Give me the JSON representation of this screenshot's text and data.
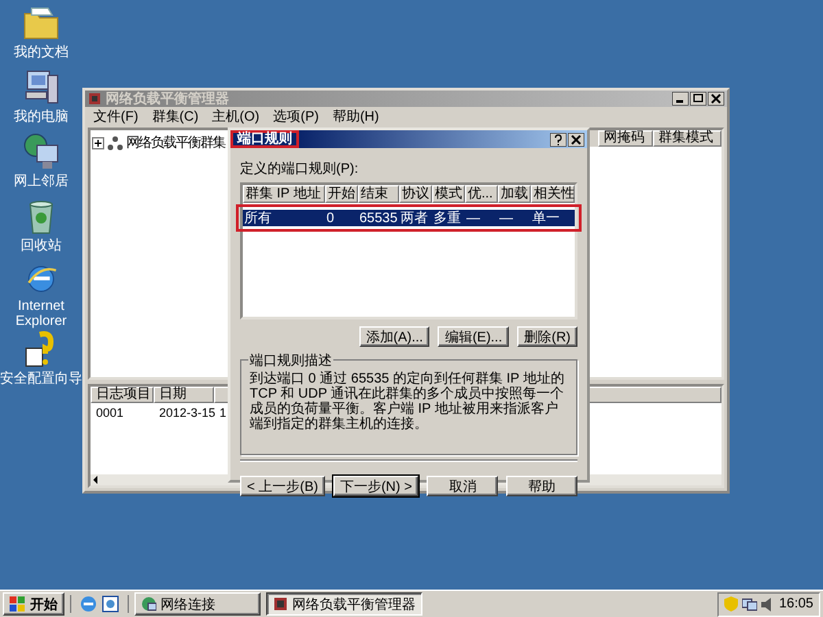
{
  "desktop_icons": [
    {
      "label": "我的文档",
      "kind": "folder"
    },
    {
      "label": "我的电脑",
      "kind": "computer"
    },
    {
      "label": "网上邻居",
      "kind": "network"
    },
    {
      "label": "回收站",
      "kind": "bin"
    },
    {
      "label": "Internet Explorer",
      "kind": "browser"
    },
    {
      "label": "安全配置向导",
      "kind": "wizard"
    }
  ],
  "main_window": {
    "title": "网络负载平衡管理器",
    "menu": [
      "文件(F)",
      "群集(C)",
      "主机(O)",
      "选项(P)",
      "帮助(H)"
    ],
    "tree": [
      {
        "label": "网络负载平衡群集",
        "expanded": false
      }
    ],
    "host_columns": [
      "网掩码",
      "群集模式"
    ],
    "log": {
      "columns": [
        "日志项目",
        "日期"
      ],
      "rows": [
        [
          "0001",
          "2012-3-15",
          "1"
        ]
      ]
    }
  },
  "dialog": {
    "title": "端口规则",
    "rules_label": "定义的端口规则(P):",
    "columns": [
      "群集 IP 地址",
      "开始",
      "结束",
      "协议",
      "模式",
      "优...",
      "加载",
      "相关性"
    ],
    "rows": [
      {
        "cells": [
          "所有",
          "0",
          "65535",
          "两者",
          "多重",
          "—",
          "—",
          "单一"
        ],
        "selected": true
      }
    ],
    "rule_buttons": [
      "添加(A)...",
      "编辑(E)...",
      "删除(R)"
    ],
    "description_title": "端口规则描述",
    "description": "到达端口 0 通过 65535 的定向到任何群集 IP 地址的 TCP 和 UDP 通讯在此群集的多个成员中按照每一个成员的负荷量平衡。客户端 IP 地址被用来指派客户端到指定的群集主机的连接。",
    "nav_buttons": [
      {
        "label": "< 上一步(B)",
        "default": false
      },
      {
        "label": "下一步(N) >",
        "default": true
      },
      {
        "label": "取消",
        "default": false
      },
      {
        "label": "帮助",
        "default": false
      }
    ]
  },
  "taskbar": {
    "start": "开始",
    "tasks": [
      {
        "label": "网络连接",
        "selected": false
      },
      {
        "label": "网络负载平衡管理器",
        "selected": true
      }
    ],
    "clock": "16:05"
  }
}
